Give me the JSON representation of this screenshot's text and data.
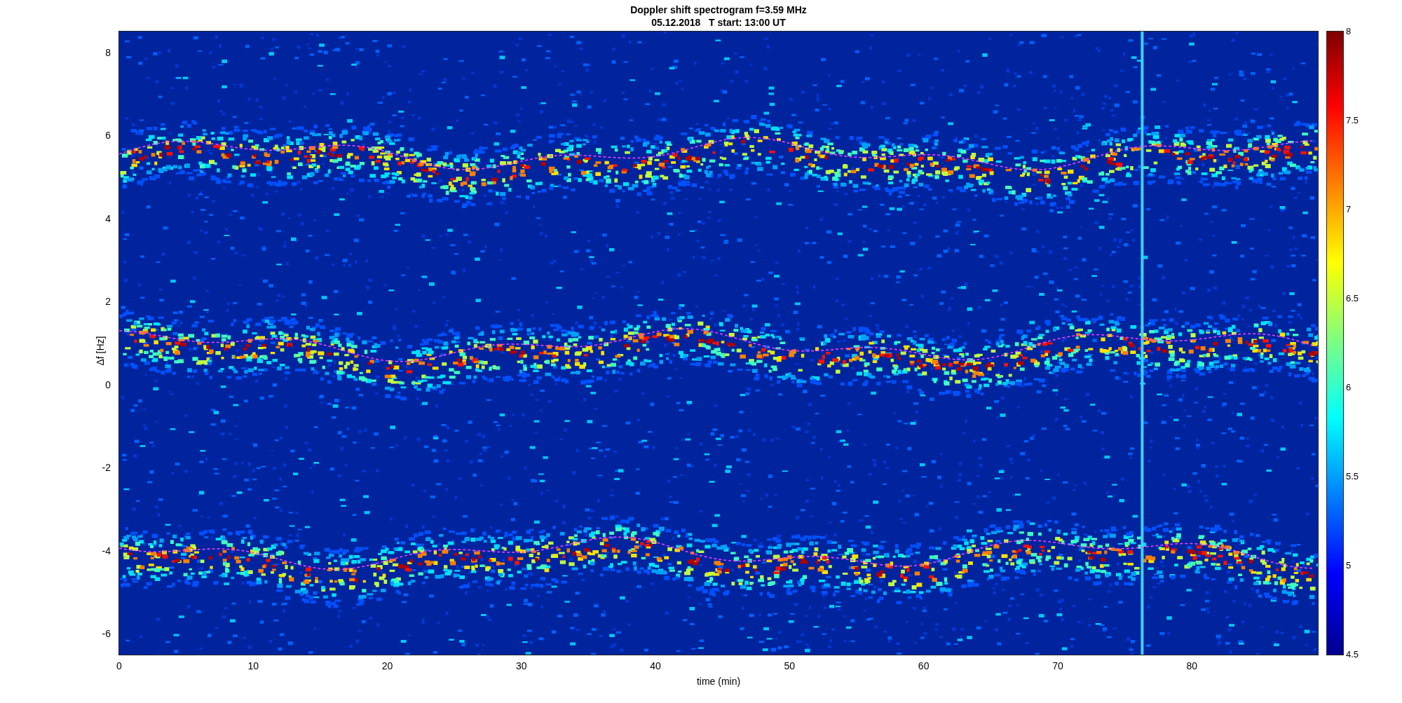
{
  "chart": {
    "title": "Doppler shift spectrogram f=3.59 MHz",
    "subtitle": "05.12.2018   T start: 13:00 UT",
    "ylabel": "Δf [Hz]",
    "xlabel": "time (min)",
    "yticks": [
      "8",
      "6",
      "4",
      "2",
      "0",
      "-2",
      "-4",
      "-6"
    ],
    "xticks": [
      "0",
      "10",
      "20",
      "30",
      "40",
      "50",
      "60",
      "70",
      "80"
    ],
    "colorbar_ticks": [
      "8",
      "7.5",
      "7",
      "6.5",
      "6",
      "5.5",
      "5",
      "4.5"
    ]
  }
}
